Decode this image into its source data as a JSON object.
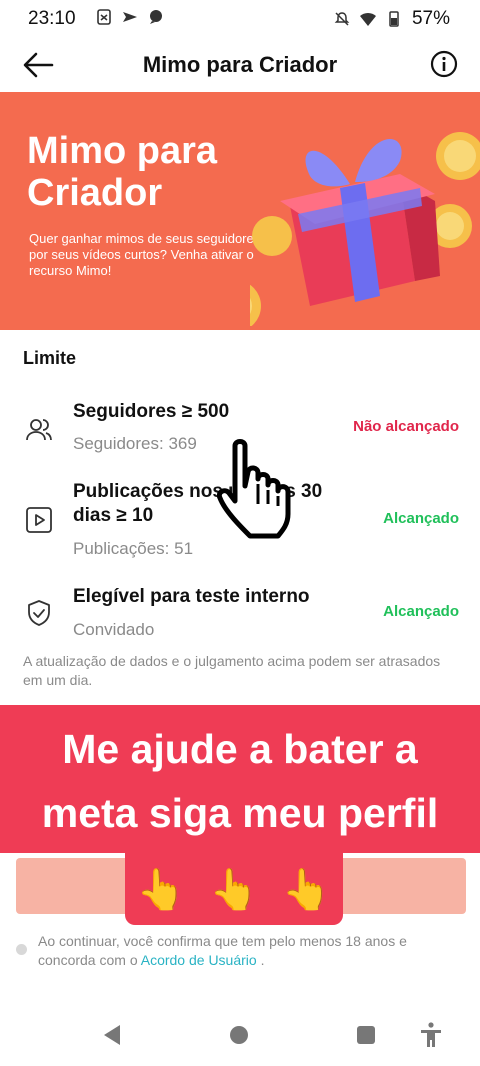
{
  "status_bar": {
    "time": "23:10",
    "battery": "57%"
  },
  "header": {
    "title": "Mimo para Criador"
  },
  "banner": {
    "headline": "Mimo para Criador",
    "subtitle": "Quer ganhar mimos de seus seguidores por seus vídeos curtos? Venha ativar o recurso Mimo!"
  },
  "limits": {
    "title": "Limite",
    "items": [
      {
        "title": "Seguidores ≥ 500",
        "detail": "Seguidores: 369",
        "status": "Não alcançado",
        "icon": "followers-icon"
      },
      {
        "title": "Publicações nos últimos 30 dias ≥ 10",
        "detail": "Publicações: 51",
        "status": "Alcançado",
        "icon": "video-icon"
      },
      {
        "title": "Elegível para teste interno",
        "detail": "Convidado",
        "status": "Alcançado",
        "icon": "shield-check-icon"
      }
    ],
    "note": "A atualização de dados e o julgamento acima podem ser atrasados em um dia."
  },
  "overlay": {
    "line1": "Me ajude a bater a",
    "line2": "meta siga meu perfil",
    "emojis": [
      "👆",
      "👆",
      "👆"
    ]
  },
  "consent": {
    "text": "Ao continuar, você confirma que tem pelo menos 18 anos e concorda com o ",
    "link": "Acordo de Usuário",
    "suffix": " ."
  },
  "colors": {
    "banner": "#f46b4f",
    "overlay": "#ef3c55",
    "not_reached": "#e0264b",
    "reached": "#20c05a",
    "link": "#2ab3c4"
  }
}
